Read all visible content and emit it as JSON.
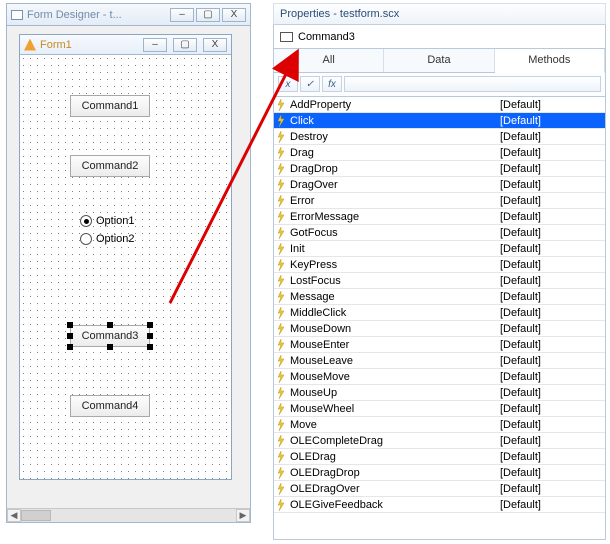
{
  "designer": {
    "title": "Form Designer - t...",
    "form1_title": "Form1",
    "buttons": {
      "cmd1": "Command1",
      "cmd2": "Command2",
      "cmd3": "Command3",
      "cmd4": "Command4"
    },
    "options": {
      "opt1": "Option1",
      "opt2": "Option2"
    },
    "window_buttons": {
      "min": "–",
      "max": "▢",
      "close": "X"
    }
  },
  "properties": {
    "title": "Properties - testform.scx",
    "object_name": "Command3",
    "tabs": {
      "all": "All",
      "data": "Data",
      "methods": "Methods"
    },
    "filter_buttons": {
      "f1": "x",
      "f2": "✓",
      "f3": "fx",
      "f4": ""
    },
    "methods": [
      {
        "name": "AddProperty",
        "value": "[Default]"
      },
      {
        "name": "Click",
        "value": "[Default]"
      },
      {
        "name": "Destroy",
        "value": "[Default]"
      },
      {
        "name": "Drag",
        "value": "[Default]"
      },
      {
        "name": "DragDrop",
        "value": "[Default]"
      },
      {
        "name": "DragOver",
        "value": "[Default]"
      },
      {
        "name": "Error",
        "value": "[Default]"
      },
      {
        "name": "ErrorMessage",
        "value": "[Default]"
      },
      {
        "name": "GotFocus",
        "value": "[Default]"
      },
      {
        "name": "Init",
        "value": "[Default]"
      },
      {
        "name": "KeyPress",
        "value": "[Default]"
      },
      {
        "name": "LostFocus",
        "value": "[Default]"
      },
      {
        "name": "Message",
        "value": "[Default]"
      },
      {
        "name": "MiddleClick",
        "value": "[Default]"
      },
      {
        "name": "MouseDown",
        "value": "[Default]"
      },
      {
        "name": "MouseEnter",
        "value": "[Default]"
      },
      {
        "name": "MouseLeave",
        "value": "[Default]"
      },
      {
        "name": "MouseMove",
        "value": "[Default]"
      },
      {
        "name": "MouseUp",
        "value": "[Default]"
      },
      {
        "name": "MouseWheel",
        "value": "[Default]"
      },
      {
        "name": "Move",
        "value": "[Default]"
      },
      {
        "name": "OLECompleteDrag",
        "value": "[Default]"
      },
      {
        "name": "OLEDrag",
        "value": "[Default]"
      },
      {
        "name": "OLEDragDrop",
        "value": "[Default]"
      },
      {
        "name": "OLEDragOver",
        "value": "[Default]"
      },
      {
        "name": "OLEGiveFeedback",
        "value": "[Default]"
      }
    ],
    "selected_index": 1
  }
}
